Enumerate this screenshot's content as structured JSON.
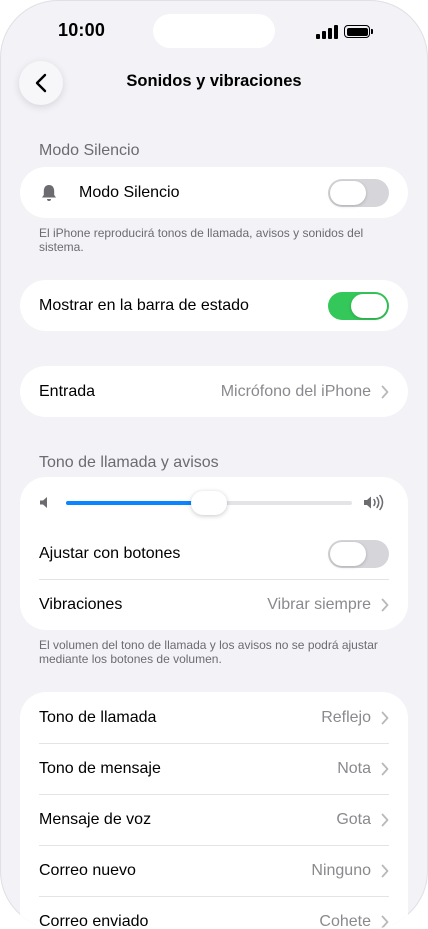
{
  "status": {
    "time": "10:00"
  },
  "nav": {
    "title": "Sonidos y vibraciones"
  },
  "silent": {
    "header": "Modo Silencio",
    "row_label": "Modo Silencio",
    "enabled": false,
    "footnote": "El iPhone reproducirá tonos de llamada, avisos y sonidos del sistema."
  },
  "status_bar_toggle": {
    "label": "Mostrar en la barra de estado",
    "enabled": true
  },
  "input": {
    "label": "Entrada",
    "value": "Micrófono del iPhone"
  },
  "ringtone_section": {
    "header": "Tono de llamada y avisos",
    "volume_level": 0.5,
    "adjust_with_buttons": {
      "label": "Ajustar con botones",
      "enabled": false
    },
    "vibrations": {
      "label": "Vibraciones",
      "value": "Vibrar siempre"
    },
    "footnote": "El volumen del tono de llamada y los avisos no se podrá ajustar mediante los botones de volumen."
  },
  "tones": [
    {
      "label": "Tono de llamada",
      "value": "Reflejo"
    },
    {
      "label": "Tono de mensaje",
      "value": "Nota"
    },
    {
      "label": "Mensaje de voz",
      "value": "Gota"
    },
    {
      "label": "Correo nuevo",
      "value": "Ninguno"
    },
    {
      "label": "Correo enviado",
      "value": "Cohete"
    }
  ],
  "colors": {
    "accent": "#0a84ff",
    "toggle_on": "#34c759",
    "toggle_off": "#d6d6da",
    "background": "#f2f2f7"
  }
}
